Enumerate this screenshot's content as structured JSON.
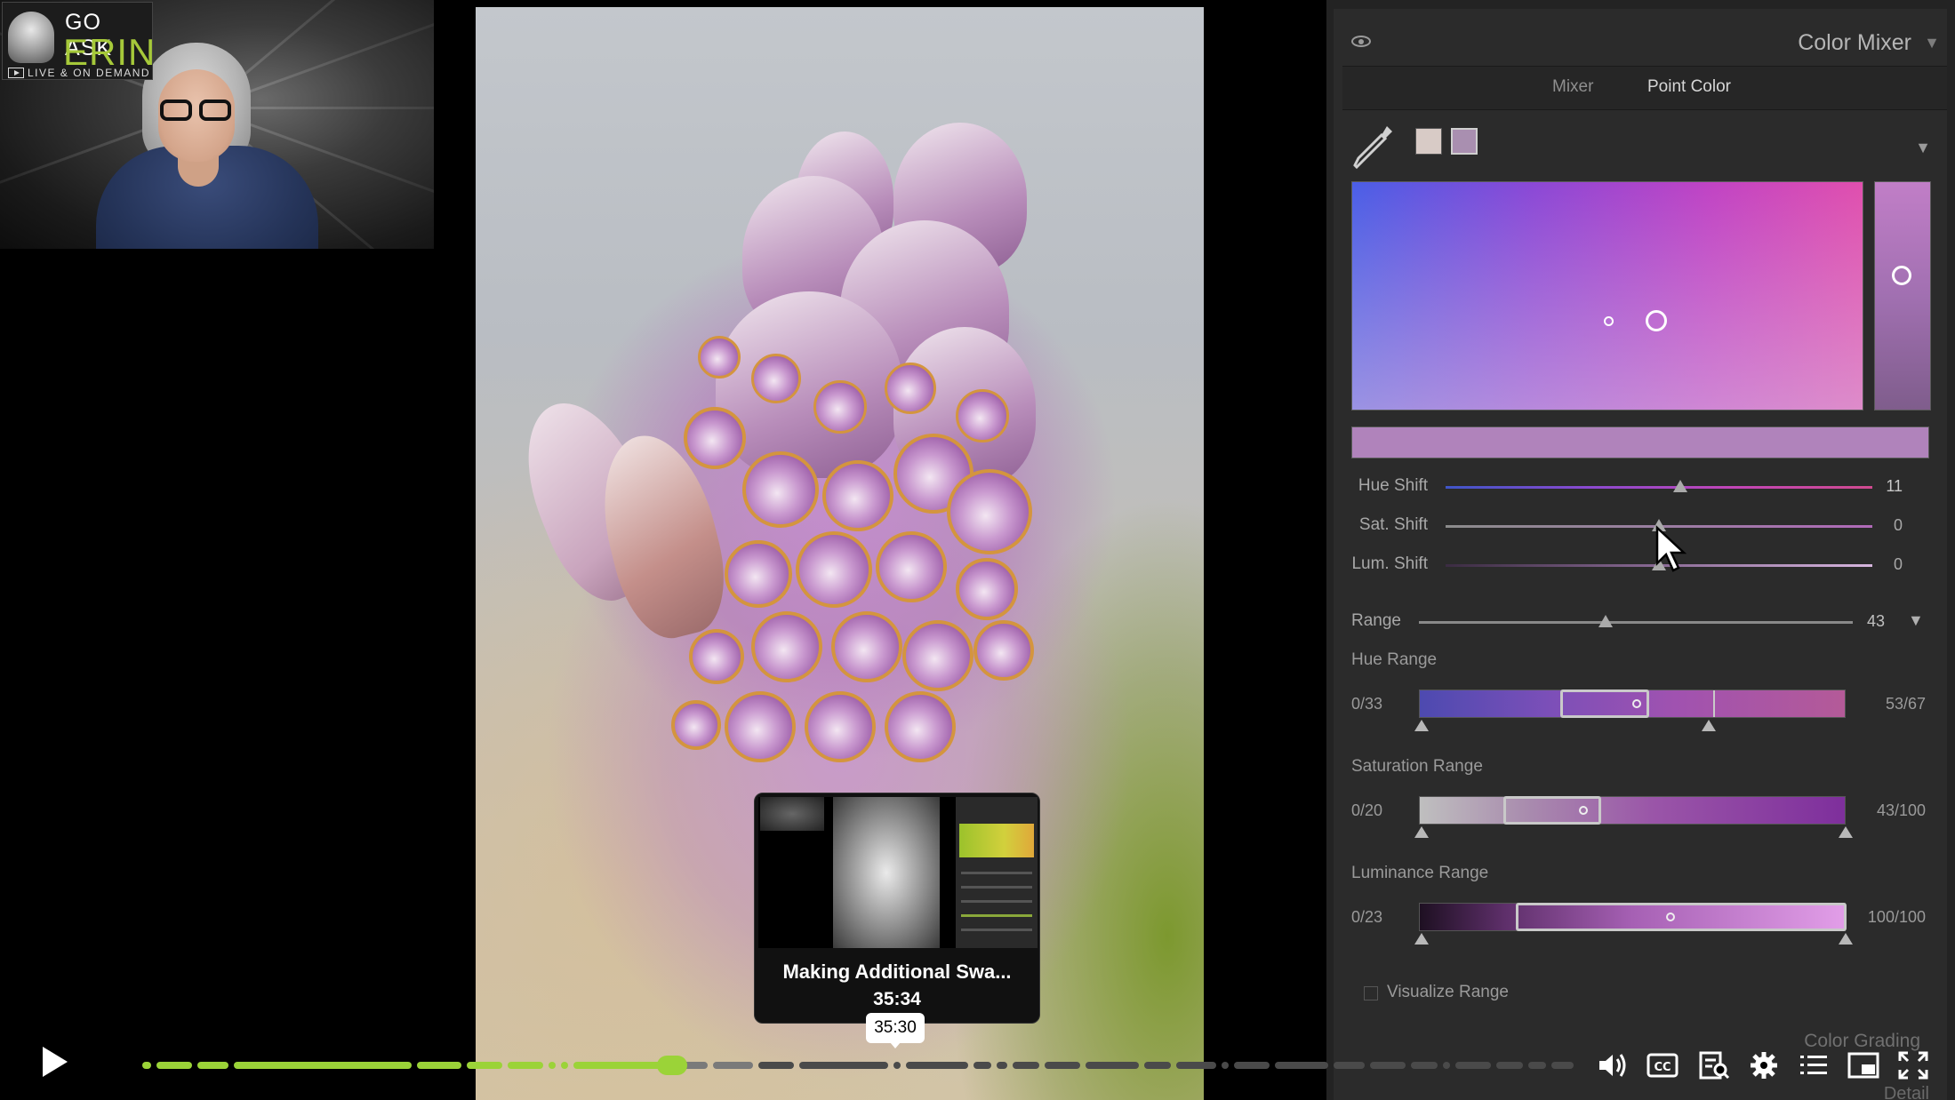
{
  "webcam": {
    "logo_line1": "GO ASK",
    "logo_line2": "ERIN",
    "logo_line3": "LIVE & ON DEMAND"
  },
  "panel": {
    "title": "Color Mixer",
    "tabs": [
      "Mixer",
      "Point Color"
    ],
    "active_tab": "Point Color",
    "swatches": [
      "#d8cbc6",
      "#a98fb0"
    ],
    "sliders": [
      {
        "label": "Hue Shift",
        "value": "11",
        "position": 0.55
      },
      {
        "label": "Sat. Shift",
        "value": "0",
        "position": 0.5
      },
      {
        "label": "Lum. Shift",
        "value": "0",
        "position": 0.5
      }
    ],
    "range": {
      "label": "Range",
      "value": "43",
      "position": 0.43
    },
    "hue_range": {
      "label": "Hue Range",
      "min": "0/33",
      "max": "53/67"
    },
    "saturation_range": {
      "label": "Saturation Range",
      "min": "0/20",
      "max": "43/100"
    },
    "luminance_range": {
      "label": "Luminance Range",
      "min": "0/23",
      "max": "100/100"
    },
    "visualize_label": "Visualize Range",
    "next_section": "Color Grading",
    "detail_section": "Detail"
  },
  "preview": {
    "title": "Making Additional Swa...",
    "time": "35:34",
    "hover_time": "35:30"
  },
  "player": {
    "progress": 0.37,
    "accent_color": "#9bd338"
  },
  "icons": [
    "play-icon",
    "volume-icon",
    "cc-icon",
    "transcript-icon",
    "settings-icon",
    "chapters-icon",
    "pip-icon",
    "fullscreen-icon",
    "eye-icon",
    "eyedropper-icon"
  ]
}
